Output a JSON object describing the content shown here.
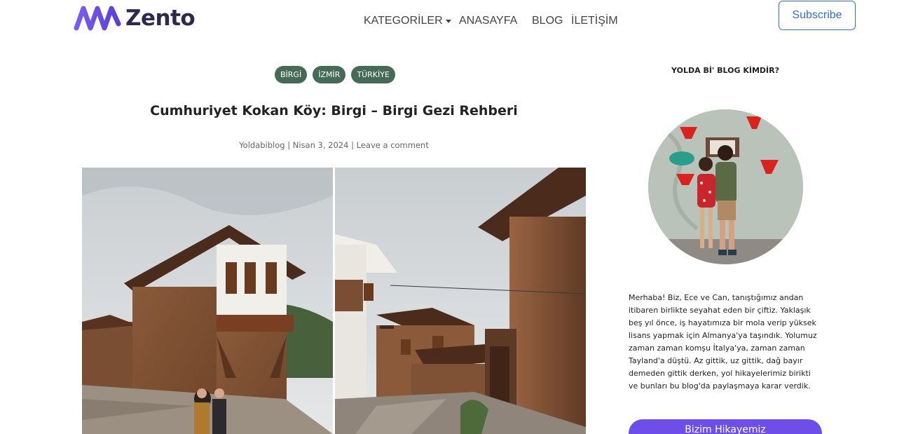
{
  "brand": {
    "name": "Zento",
    "color": "#6d4ee8"
  },
  "nav": {
    "items": [
      "KATEGORİLER",
      "ANASAYFA",
      "BLOG",
      "İLETİŞİM"
    ]
  },
  "subscribe_label": "Subscribe",
  "post": {
    "tags": [
      "BİRGİ",
      "İZMİR",
      "TÜRKİYE"
    ],
    "title": "Cumhuriyet Kokan Köy: Birgi – Birgi Gezi Rehberi",
    "author": "Yoldabiblog",
    "date": "Nisan 3, 2024",
    "comment_link": "Leave a comment",
    "separator": "|"
  },
  "sidebar": {
    "heading": "YOLDA Bİ' BLOG KİMDİR?",
    "bio": "Merhaba! Biz, Ece ve Can, tanıştığımız andan itibaren birlikte seyahat eden bir çiftiz. Yaklaşık beş yıl önce, iş hayatımıza bir mola verip yüksek lisans yapmak için Almanya'ya taşındık. Yolumuz zaman zaman komşu İtalya'ya, zaman zaman Tayland'a düştü. Az gittik, uz gittik, dağ bayır demeden gittik derken, yol hikayelerimiz birikti ve bunları bu blog'da paylaşmaya karar verdik.",
    "button_label": "Bizim Hikayemiz"
  }
}
